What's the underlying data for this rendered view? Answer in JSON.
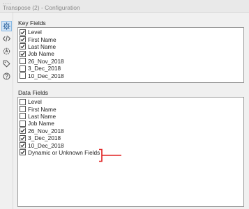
{
  "window": {
    "title": "Transpose (2) - Configuration",
    "grip": "...."
  },
  "rail": {
    "items": [
      {
        "icon": "gear-icon",
        "active": true
      },
      {
        "icon": "code-icon",
        "active": false
      },
      {
        "icon": "annotation-icon",
        "active": false
      },
      {
        "icon": "tag-icon",
        "active": false
      },
      {
        "icon": "help-icon",
        "active": false
      }
    ]
  },
  "key_fields": {
    "label": "Key Fields",
    "items": [
      {
        "label": "Level",
        "checked": true
      },
      {
        "label": "First Name",
        "checked": true
      },
      {
        "label": "Last Name",
        "checked": true
      },
      {
        "label": "Job Name",
        "checked": true
      },
      {
        "label": "26_Nov_2018",
        "checked": false
      },
      {
        "label": "3_Dec_2018",
        "checked": false
      },
      {
        "label": "10_Dec_2018",
        "checked": false
      }
    ]
  },
  "data_fields": {
    "label": "Data Fields",
    "items": [
      {
        "label": "Level",
        "checked": false
      },
      {
        "label": "First Name",
        "checked": false
      },
      {
        "label": "Last Name",
        "checked": false
      },
      {
        "label": "Job Name",
        "checked": false
      },
      {
        "label": "26_Nov_2018",
        "checked": true
      },
      {
        "label": "3_Dec_2018",
        "checked": true
      },
      {
        "label": "10_Dec_2018",
        "checked": true
      },
      {
        "label": "Dynamic or Unknown Fields",
        "checked": true
      }
    ]
  },
  "colors": {
    "annotation": "#e02020",
    "active_rail": "#cfe3f6"
  }
}
